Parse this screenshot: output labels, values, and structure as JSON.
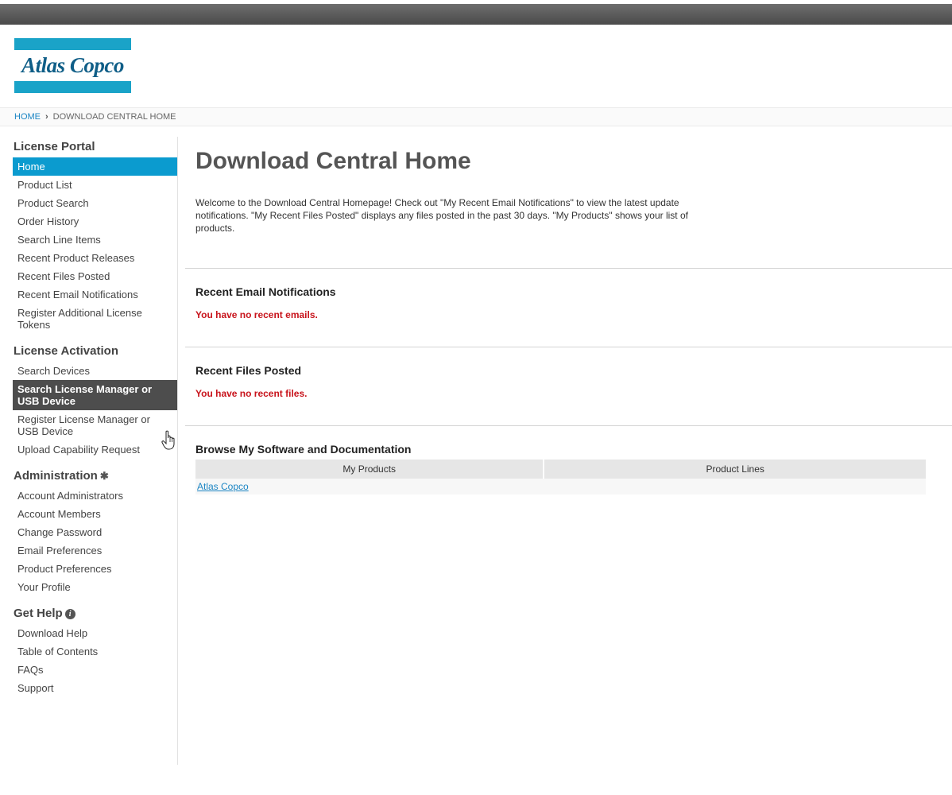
{
  "brand": {
    "name": "Atlas Copco",
    "colors": {
      "logo_bar": "#1aa3c8",
      "logo_text": "#0f5e87",
      "active": "#0b9bcf",
      "hover": "#4d4d4d",
      "error": "#c8141c",
      "link": "#1d86c4"
    }
  },
  "breadcrumb": {
    "home": "HOME",
    "separator": "›",
    "current": "DOWNLOAD CENTRAL HOME"
  },
  "sidebar": {
    "sections": [
      {
        "title": "License Portal",
        "icon": "",
        "items": [
          "Home",
          "Product List",
          "Product Search",
          "Order History",
          "Search Line Items",
          "Recent Product Releases",
          "Recent Files Posted",
          "Recent Email Notifications",
          "Register Additional License Tokens"
        ]
      },
      {
        "title": "License Activation",
        "icon": "",
        "items": [
          "Search Devices",
          "Search License Manager or USB Device",
          "Register License Manager or USB Device",
          "Upload Capability Request"
        ]
      },
      {
        "title": "Administration",
        "icon": "gear-icon",
        "items": [
          "Account Administrators",
          "Account Members",
          "Change Password",
          "Email Preferences",
          "Product Preferences",
          "Your Profile"
        ]
      },
      {
        "title": "Get Help",
        "icon": "info-icon",
        "items": [
          "Download Help",
          "Table of Contents",
          "FAQs",
          "Support"
        ]
      }
    ],
    "active_item": "Home",
    "hover_item": "Search License Manager or USB Device"
  },
  "main": {
    "title": "Download Central Home",
    "intro": "Welcome to the Download Central Homepage! Check out \"My Recent Email Notifications\" to view the latest update notifications. \"My Recent Files Posted\" displays any files posted in the past 30 days. \"My Products\" shows your list of products.",
    "email_section": {
      "title": "Recent Email Notifications",
      "empty": "You have no recent emails."
    },
    "files_section": {
      "title": "Recent Files Posted",
      "empty": "You have no recent files."
    },
    "browse_section": {
      "title": "Browse My Software and Documentation",
      "columns": [
        "My Products",
        "Product Lines"
      ],
      "rows": [
        [
          "Atlas Copco",
          ""
        ]
      ]
    }
  }
}
